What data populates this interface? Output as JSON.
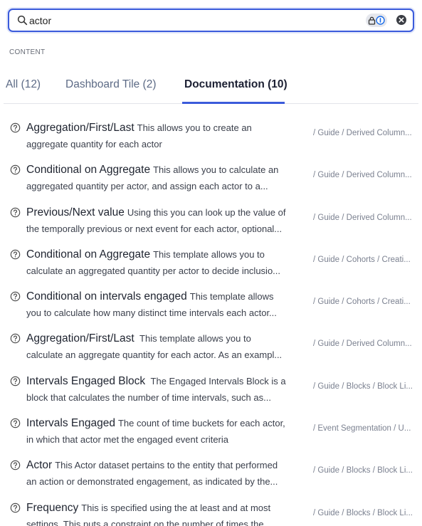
{
  "search": {
    "value": "actor",
    "placeholder": "Search"
  },
  "section_label": "CONTENT",
  "tabs": [
    {
      "label": "All (12)"
    },
    {
      "label": "Dashboard Tile (2)"
    },
    {
      "label": "Documentation (10)"
    }
  ],
  "results": [
    {
      "title": "Aggregation/First/Last",
      "desc1": "This allows you to create an",
      "desc2": "aggregate quantity for each actor",
      "path": "/ Guide / Derived Column..."
    },
    {
      "title": "Conditional on Aggregate",
      "desc1": "This allows you to calculate an",
      "desc2": "aggregated quantity per actor, and assign each actor to a...",
      "path": "/ Guide / Derived Column..."
    },
    {
      "title": "Previous/Next value",
      "desc1": "Using this you can look up the value of",
      "desc2": "the temporally previous or next event for each actor, optional...",
      "path": "/ Guide / Derived Column..."
    },
    {
      "title": "Conditional on Aggregate",
      "desc1": "This template allows you to",
      "desc2": "calculate an aggregated quantity per actor to decide inclusio...",
      "path": "/ Guide / Cohorts / Creati..."
    },
    {
      "title": "Conditional on intervals engaged",
      "desc1": "This template allows",
      "desc2": "you to calculate how many distinct time intervals each actor...",
      "path": "/ Guide / Cohorts / Creati..."
    },
    {
      "title": "Aggregation/First/Last",
      "desc1": " This template allows you to",
      "desc2": "calculate an aggregate quantity for each actor. As an exampl...",
      "path": "/ Guide / Derived Column..."
    },
    {
      "title": "Intervals Engaged Block",
      "desc1": " The Engaged Intervals Block is a",
      "desc2": "block that calculates the number of time intervals, such as...",
      "path": "/ Guide / Blocks / Block Li..."
    },
    {
      "title": "Intervals Engaged",
      "desc1": "The count of time buckets for each actor,",
      "desc2": "in which that actor met the engaged event criteria",
      "path": "/ Event Segmentation / U..."
    },
    {
      "title": "Actor",
      "desc1": "This Actor dataset pertains to the entity that performed",
      "desc2": "an action or demonstrated engagement, as indicated by the...",
      "path": "/ Guide / Blocks / Block Li..."
    },
    {
      "title": "Frequency",
      "desc1": "This is specified using the at least and at most",
      "desc2": "settings. This puts a constraint on the number of times the...",
      "path": "/ Guide / Blocks / Block Li..."
    }
  ],
  "colors": {
    "accent": "#3b5bdb",
    "text": "#1f2430",
    "muted": "#7b8190"
  }
}
